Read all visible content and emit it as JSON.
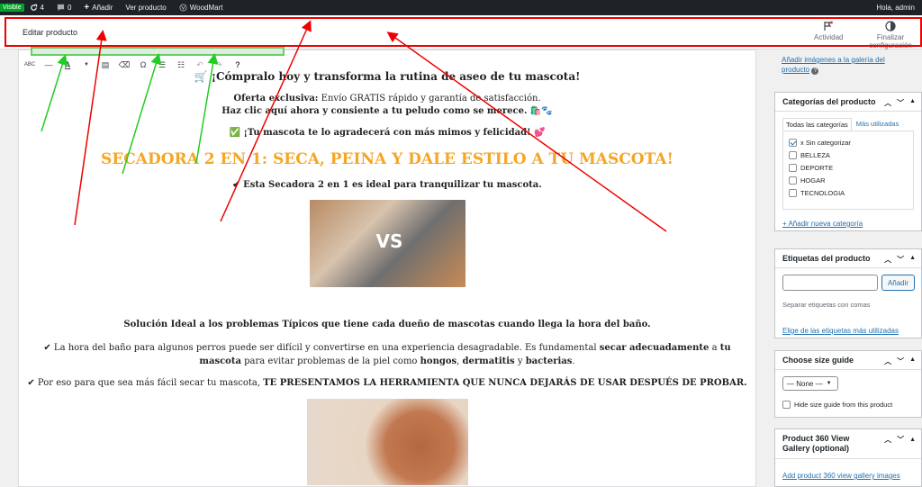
{
  "adminbar": {
    "visible_badge": "Visible",
    "updates_count": "4",
    "comments_count": "0",
    "add_label": "Añadir",
    "view_label": "Ver producto",
    "woodmart_label": "WoodMart",
    "greeting": "Hola, admin"
  },
  "header": {
    "title": "Editar producto",
    "activity_label": "Actividad",
    "finish_label": "Finalizar configuración"
  },
  "editor": {
    "line1": "🛒 ¡Cómpralo hoy y transforma la rutina de aseo de tu mascota!",
    "line2_bold": "Oferta exclusiva:",
    "line2_rest": " Envío GRATIS rápido y garantía de satisfacción.",
    "line3": "Haz clic aquí ahora y consiente a tu peludo como se merece. 🛍️🐾",
    "line4": "✅ ¡Tu mascota te lo agradecerá con más mimos y felicidad! 💕",
    "title": "SECADORA 2 EN 1: SECA, PEINA Y DALE ESTILO A TU MASCOTA!",
    "line5": "✔ Esta Secadora 2 en 1 es ideal para tranquilizar tu mascota.",
    "image1_text": "VS",
    "line6": "Solución Ideal a los problemas Típicos que tiene cada dueño de mascotas cuando llega la hora del baño.",
    "p1_a": "✔ La hora del baño para algunos perros puede ser difícil y convertirse en una experiencia desagradable. Es fundamental ",
    "p1_b": "secar adecuadamente",
    "p1_c": " a ",
    "p1_d": "tu mascota",
    "p1_e": " para evitar problemas de la piel como ",
    "p1_f": "hongos",
    "p1_g": ", ",
    "p1_h": "dermatitis",
    "p1_i": " y ",
    "p1_j": "bacterias",
    "p1_k": ".",
    "line7_a": "✔ Por eso para que sea más fácil secar tu mascota, ",
    "line7_b": "TE PRESENTAMOS LA HERRAMIENTA QUE NUNCA DEJARÁS DE USAR DESPUÉS DE PROBAR."
  },
  "sidebar": {
    "gallery_link": "Añadir imágenes a la galería del producto",
    "categories": {
      "title": "Categorías del producto",
      "tab_all": "Todas las categorías",
      "tab_used": "Más utilizadas",
      "items": [
        {
          "label": "x Sin categorizar",
          "checked": true
        },
        {
          "label": "BELLEZA",
          "checked": false
        },
        {
          "label": "DEPORTE",
          "checked": false
        },
        {
          "label": "HOGAR",
          "checked": false
        },
        {
          "label": "TECNOLOGIA",
          "checked": false
        }
      ],
      "add_link": "+ Añadir nueva categoría"
    },
    "tags": {
      "title": "Etiquetas del producto",
      "add_button": "Añadir",
      "hint": "Separar etiquetas con comas",
      "choose_link": "Elige de las etiquetas más utilizadas"
    },
    "size_guide": {
      "title": "Choose size guide",
      "select_value": "— None —",
      "hide_label": "Hide size guide from this product"
    },
    "gallery360": {
      "title": "Product 360 View Gallery (optional)",
      "add_link": "Add product 360 view gallery images"
    }
  }
}
